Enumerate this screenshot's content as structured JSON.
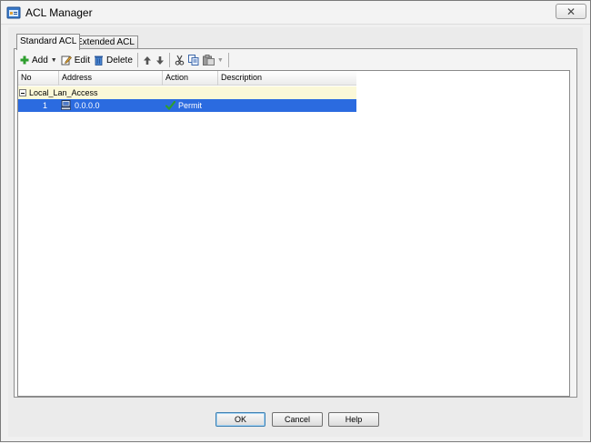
{
  "window": {
    "title": "ACL Manager",
    "close_symbol": "✕"
  },
  "tabs": [
    {
      "label": "Standard ACL",
      "active": true
    },
    {
      "label": "Extended ACL",
      "active": false
    }
  ],
  "toolbar": {
    "add_label": "Add",
    "edit_label": "Edit",
    "delete_label": "Delete",
    "dropdown_symbol": "▼"
  },
  "table": {
    "columns": [
      "No",
      "Address",
      "Action",
      "Description"
    ],
    "groups": [
      {
        "name": "Local_Lan_Access",
        "expander": "minus",
        "rows": [
          {
            "no": "1",
            "address": "0.0.0.0",
            "action": "Permit",
            "description": ""
          }
        ]
      }
    ]
  },
  "buttons": {
    "ok": "OK",
    "cancel": "Cancel",
    "help": "Help"
  },
  "colors": {
    "selection": "#2b6be0",
    "group_row": "#fbf8d8",
    "permit_check": "#2e9e2e",
    "add_plus": "#2e9e2e"
  },
  "icons": {
    "app": "acl-manager-icon",
    "add": "plus-icon",
    "edit": "edit-icon",
    "delete": "trash-icon",
    "move_up": "arrow-up-icon",
    "move_down": "arrow-down-icon",
    "cut": "scissors-icon",
    "copy": "copy-icon",
    "paste": "paste-icon",
    "address": "network-host-icon",
    "action": "checkmark-icon"
  }
}
